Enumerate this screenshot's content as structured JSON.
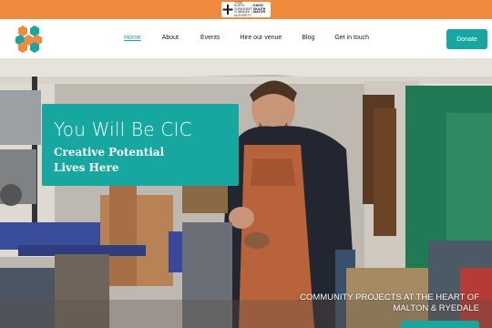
{
  "colors": {
    "teal": "#16a7a0",
    "orange": "#f08a3c"
  },
  "top_strip": {
    "partner_logo_line1": "YORK NORTH YORKSHIRE COMBINED AUTHORITY",
    "partner_logo_line2": "DAVID SKAITH MAYOR"
  },
  "nav": {
    "logo_icon": "hexagon-cluster-icon",
    "items": [
      {
        "label": "Home",
        "active": true
      },
      {
        "label": "About"
      },
      {
        "label": "Events"
      },
      {
        "label": "Hire our venue"
      },
      {
        "label": "Blog"
      },
      {
        "label": "Get in touch"
      }
    ],
    "donate_label": "Donate"
  },
  "hero": {
    "title": "You Will Be CIC",
    "subtitle_line1": "Creative Potential",
    "subtitle_line2": "Lives Here",
    "tagline_line1": "COMMUNITY PROJECTS AT THE HEART OF",
    "tagline_line2": "MALTON & RYEDALE"
  }
}
